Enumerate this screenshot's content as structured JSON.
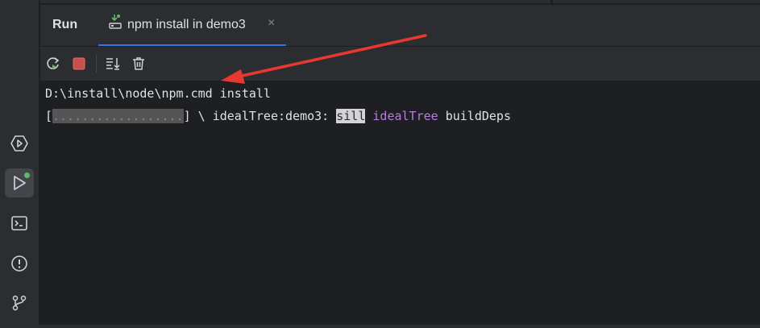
{
  "tool_window": {
    "title": "Run",
    "tab": {
      "label": "npm install in demo3",
      "icon": "npm-run-icon",
      "close_icon": "close-icon",
      "close_glyph": "×"
    }
  },
  "toolbar": {
    "rerun_icon": "rerun-icon",
    "stop_icon": "stop-icon",
    "scroll_to_end_icon": "scroll-to-end-icon",
    "clear_icon": "trash-icon"
  },
  "left_sidebar": {
    "items": [
      {
        "name": "services",
        "icon": "services-icon"
      },
      {
        "name": "run",
        "icon": "run-icon",
        "active": true,
        "badge_color": "#5fb865"
      },
      {
        "name": "terminal",
        "icon": "terminal-icon"
      },
      {
        "name": "problems",
        "icon": "problems-icon"
      },
      {
        "name": "git",
        "icon": "git-icon"
      }
    ]
  },
  "console": {
    "line1": "D:\\install\\node\\npm.cmd install",
    "line2": {
      "open_bracket": "[",
      "progress": "..................",
      "close_bracket": "]",
      "spinner": " \\ ",
      "tree_text": "idealTree:demo3: ",
      "level": "sill",
      "space": " ",
      "stage": "idealTree",
      "message": " buildDeps"
    }
  },
  "annotation": {
    "arrow_color": "#e8382f"
  },
  "colors": {
    "accent": "#3574f0",
    "bg": "#1e1f22",
    "panel": "#2b2d30",
    "purple": "#b47fd8",
    "success": "#5fb865",
    "stop": "#c94f4f"
  }
}
